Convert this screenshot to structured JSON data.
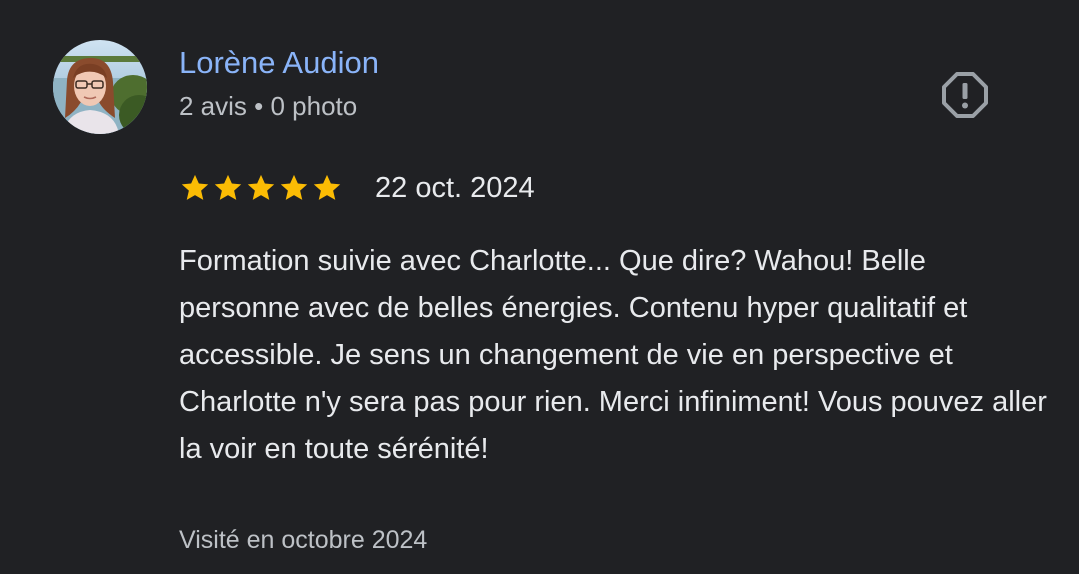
{
  "review": {
    "author_name": "Lorène Audion",
    "author_meta": "2 avis • 0 photo",
    "rating": 5,
    "rating_max": 5,
    "date": "22 oct. 2024",
    "text": "Formation suivie avec Charlotte... Que dire? Wahou! Belle personne avec de belles énergies. Contenu hyper qualitatif et accessible. Je sens un changement de vie en perspective et Charlotte n'y sera pas pour rien. Merci infiniment! Vous pouvez aller la voir en toute sérénité!",
    "visit_info": "Visité en octobre 2024"
  },
  "icons": {
    "report": "report-alert-octagon-icon",
    "star": "star-icon"
  },
  "colors": {
    "background": "#202124",
    "author_link": "#8ab4f8",
    "star": "#fbbc04",
    "secondary_text": "#bdc1c6",
    "primary_text": "#e8eaed",
    "icon": "#9aa0a6"
  }
}
